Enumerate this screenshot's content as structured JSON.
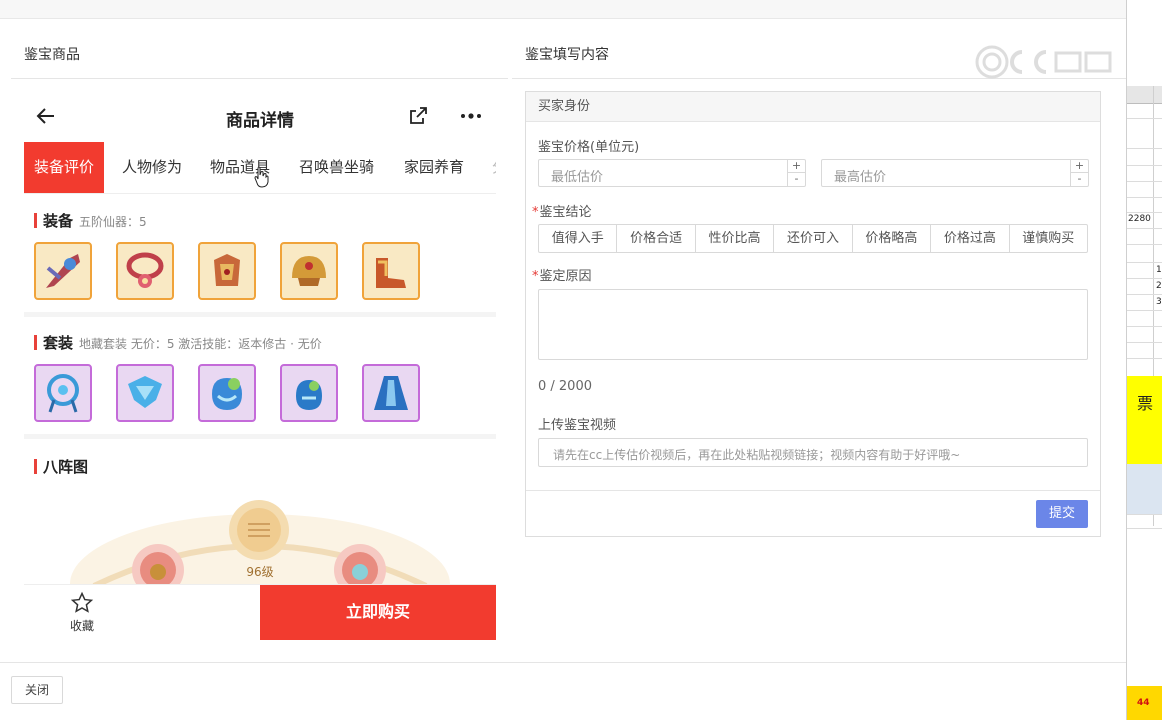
{
  "left_column": {
    "title": "鉴宝商品"
  },
  "right_column": {
    "title": "鉴宝填写内容"
  },
  "product": {
    "header_title": "商品详情",
    "tabs": [
      "装备评价",
      "人物修为",
      "物品道具",
      "召唤兽坐骑",
      "家园养育",
      "分"
    ],
    "equipment": {
      "title": "装备",
      "subtitle": "五阶仙器：5"
    },
    "suit": {
      "title": "套装",
      "subtitle": "地藏套装   无价：5   激活技能：返本修古 · 无价"
    },
    "formation": {
      "title": "八阵图",
      "level": "96级"
    },
    "footer": {
      "favorite_label": "收藏",
      "buy_label": "立即购买"
    }
  },
  "form": {
    "section_title": "买家身份",
    "price": {
      "label": "鉴宝价格(单位元)",
      "min_placeholder": "最低估价",
      "max_placeholder": "最高估价",
      "plus": "+",
      "minus": "-"
    },
    "conclusion": {
      "required_mark": "*",
      "label": "鉴宝结论",
      "options": [
        "值得入手",
        "价格合适",
        "性价比高",
        "还价可入",
        "价格略高",
        "价格过高",
        "谨慎购买"
      ]
    },
    "reason": {
      "required_mark": "*",
      "label": "鉴定原因",
      "counter": "0 / 2000"
    },
    "video": {
      "label": "上传鉴宝视频",
      "placeholder": "请先在cc上传估价视频后，再在此处粘贴视频链接；视频内容有助于好评哦~"
    },
    "submit_label": "提交"
  },
  "dialog": {
    "close_label": "关闭"
  },
  "background_sheet": {
    "cells": [
      "2280",
      "1",
      "2",
      "3",
      "票",
      "44"
    ]
  },
  "colors": {
    "accent_red": "#f23b2f",
    "submit_blue": "#6b86e8",
    "equip_gold": "#f0a33a",
    "suit_purple": "#c46bd9"
  }
}
